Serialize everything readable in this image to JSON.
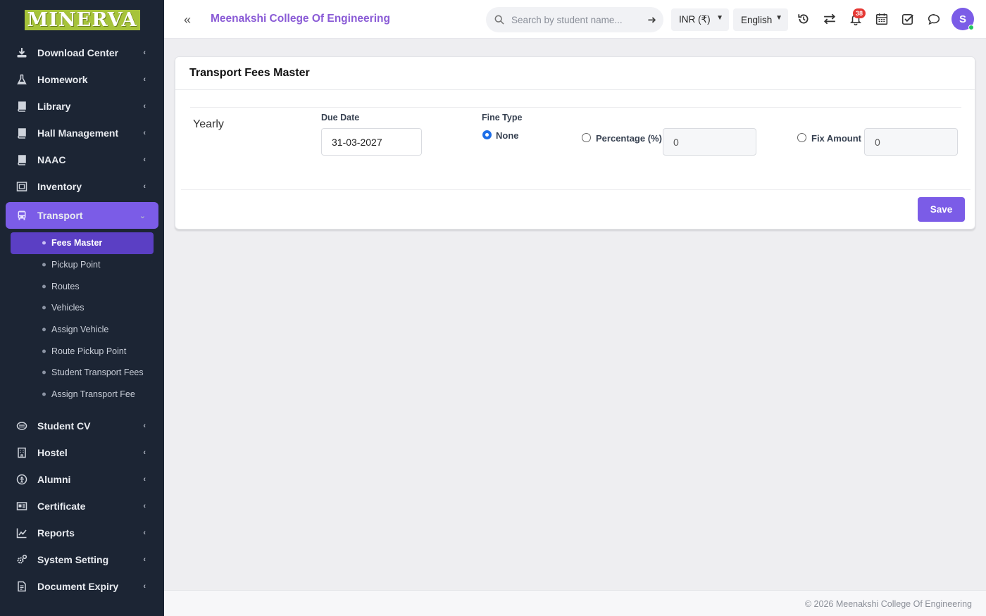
{
  "logo": {
    "text": "MINERVA"
  },
  "sidebar": {
    "items_top": [
      {
        "label": "Download Center",
        "icon": "download-icon"
      },
      {
        "label": "Homework",
        "icon": "flask-icon"
      },
      {
        "label": "Library",
        "icon": "book-icon"
      },
      {
        "label": "Hall Management",
        "icon": "book-icon"
      },
      {
        "label": "NAAC",
        "icon": "book-icon"
      },
      {
        "label": "Inventory",
        "icon": "inventory-icon"
      }
    ],
    "active_item": {
      "label": "Transport",
      "icon": "bus-icon"
    },
    "sub_items": [
      {
        "label": "Fees Master",
        "active": true
      },
      {
        "label": "Pickup Point"
      },
      {
        "label": "Routes"
      },
      {
        "label": "Vehicles"
      },
      {
        "label": "Assign Vehicle"
      },
      {
        "label": "Route Pickup Point"
      },
      {
        "label": "Student Transport Fees"
      },
      {
        "label": "Assign Transport Fee"
      }
    ],
    "items_bottom": [
      {
        "label": "Student CV",
        "icon": "cv-icon"
      },
      {
        "label": "Hostel",
        "icon": "building-icon"
      },
      {
        "label": "Alumni",
        "icon": "alumni-icon"
      },
      {
        "label": "Certificate",
        "icon": "certificate-icon"
      },
      {
        "label": "Reports",
        "icon": "chart-line-icon"
      },
      {
        "label": "System Setting",
        "icon": "gears-icon"
      },
      {
        "label": "Document Expiry",
        "icon": "document-icon"
      }
    ]
  },
  "topbar": {
    "college_name": "Meenakshi College Of Engineering",
    "search_placeholder": "Search by student name...",
    "currency": "INR (₹)",
    "language": "English",
    "notification_count": "38",
    "avatar_initial": "S"
  },
  "page": {
    "title": "Transport Fees Master",
    "frequency": "Yearly",
    "due_date_label": "Due Date",
    "due_date_value": "31-03-2027",
    "fine_type_label": "Fine Type",
    "fine_options": {
      "none": "None",
      "percentage": "Percentage (%)",
      "fix_amount": "Fix Amount"
    },
    "selected_fine_type": "None",
    "percentage_value": "0",
    "fix_amount_value": "0",
    "save_label": "Save"
  },
  "footer": {
    "copyright": "© 2026 Meenakshi College Of Engineering"
  },
  "colors": {
    "accent": "#7b5ce7",
    "sidebar_bg": "#1c2534",
    "logo_bg": "#a6c33a",
    "badge": "#e53935"
  }
}
